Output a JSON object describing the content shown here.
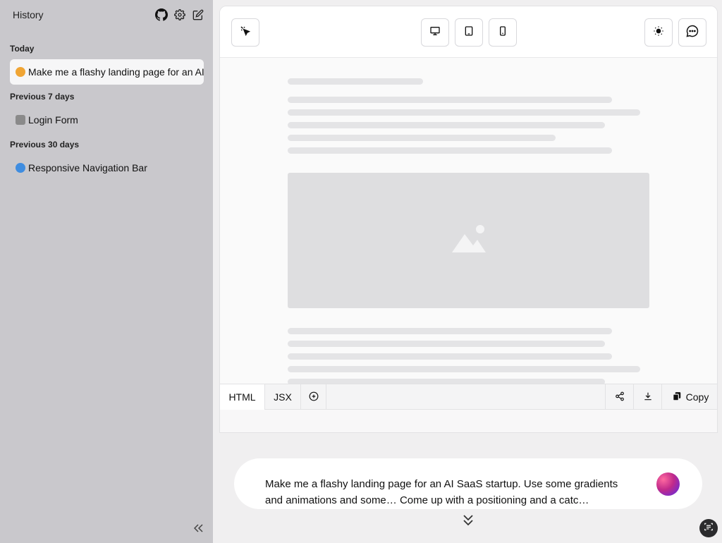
{
  "sidebar": {
    "title": "History",
    "sections": [
      {
        "label": "Today",
        "items": [
          {
            "emoji_color": "#f0a534",
            "label": "Make me a flashy landing page for an AI SaaS startup",
            "active": true
          }
        ]
      },
      {
        "label": "Previous 7 days",
        "items": [
          {
            "emoji_color": "#8a8a8a",
            "label": "Login Form",
            "active": false
          }
        ]
      },
      {
        "label": "Previous 30 days",
        "items": [
          {
            "emoji_color": "#3f8de0",
            "label": "Responsive Navigation Bar",
            "active": false
          }
        ]
      }
    ]
  },
  "toolbar": {
    "icons": [
      "cursor-select-icon",
      "desktop-icon",
      "tablet-icon",
      "mobile-icon",
      "sun-icon",
      "chat-icon"
    ]
  },
  "codebar": {
    "tabs": [
      "HTML",
      "JSX"
    ],
    "copy_label": "Copy"
  },
  "prompt": {
    "line1": "Make me a flashy landing page for an AI SaaS startup.  Use some gradients",
    "line2": "and animations and some… Come up with a positioning and a catc…"
  },
  "colors": {
    "sidebar_bg": "#c9c8cc",
    "accent_orb_start": "#ff6aa0",
    "accent_orb_end": "#6a2bd9"
  }
}
